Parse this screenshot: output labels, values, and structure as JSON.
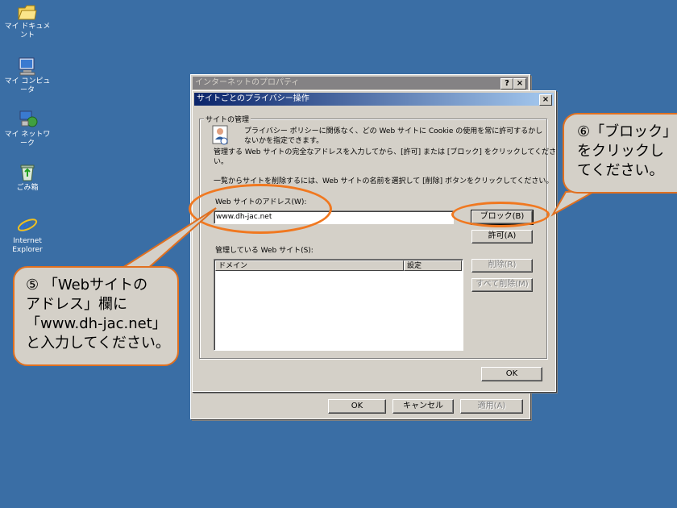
{
  "desktop": {
    "icons": [
      {
        "label": "マイ ドキュメント",
        "icon": "folder-icon"
      },
      {
        "label": "マイ コンピュータ",
        "icon": "computer-icon"
      },
      {
        "label": "マイ ネットワーク",
        "icon": "network-icon"
      },
      {
        "label": "ごみ箱",
        "icon": "recycle-bin-icon"
      },
      {
        "label": "Internet Explorer",
        "icon": "ie-icon"
      }
    ]
  },
  "back_window": {
    "title": "インターネットのプロパティ",
    "help_btn": "?",
    "close_btn": "×",
    "ok_label": "OK",
    "cancel_label": "キャンセル",
    "apply_label": "適用(A)"
  },
  "dialog": {
    "title": "サイトごとのプライバシー操作",
    "close_btn": "×",
    "group_label": "サイトの管理",
    "intro_text_1": "プライバシー ポリシーに関係なく、どの Web サイトに Cookie の使用を常に許可するかし",
    "intro_text_2": "ないかを指定できます。",
    "instruction_1": "管理する Web サイトの完全なアドレスを入力してから、[許可] または [ブロック] をクリックしてくださ",
    "instruction_2": "い。",
    "delete_instruction": "一覧からサイトを削除するには、Web サイトの名前を選択して [削除] ボタンをクリックしてください。",
    "address_label": "Web サイトのアドレス(W):",
    "address_value": "www.dh-jac.net",
    "block_label": "ブロック(B)",
    "allow_label": "許可(A)",
    "managed_label": "管理している Web サイト(S):",
    "columns": [
      "ドメイン",
      "設定"
    ],
    "remove_label": "削除(R)",
    "remove_all_label": "すべて削除(M)",
    "ok_label": "OK"
  },
  "callouts": {
    "step5": [
      "⑤ 「Webサイトの",
      "アドレス」欄に",
      "「www.dh-jac.net」",
      "と入力してください。"
    ],
    "step6": [
      "⑥「ブロック」",
      "をクリックし",
      "てください。"
    ]
  },
  "colors": {
    "desktop": "#3a6ea5",
    "callout_border": "#e07020",
    "highlight_ellipse": "#f07820"
  }
}
